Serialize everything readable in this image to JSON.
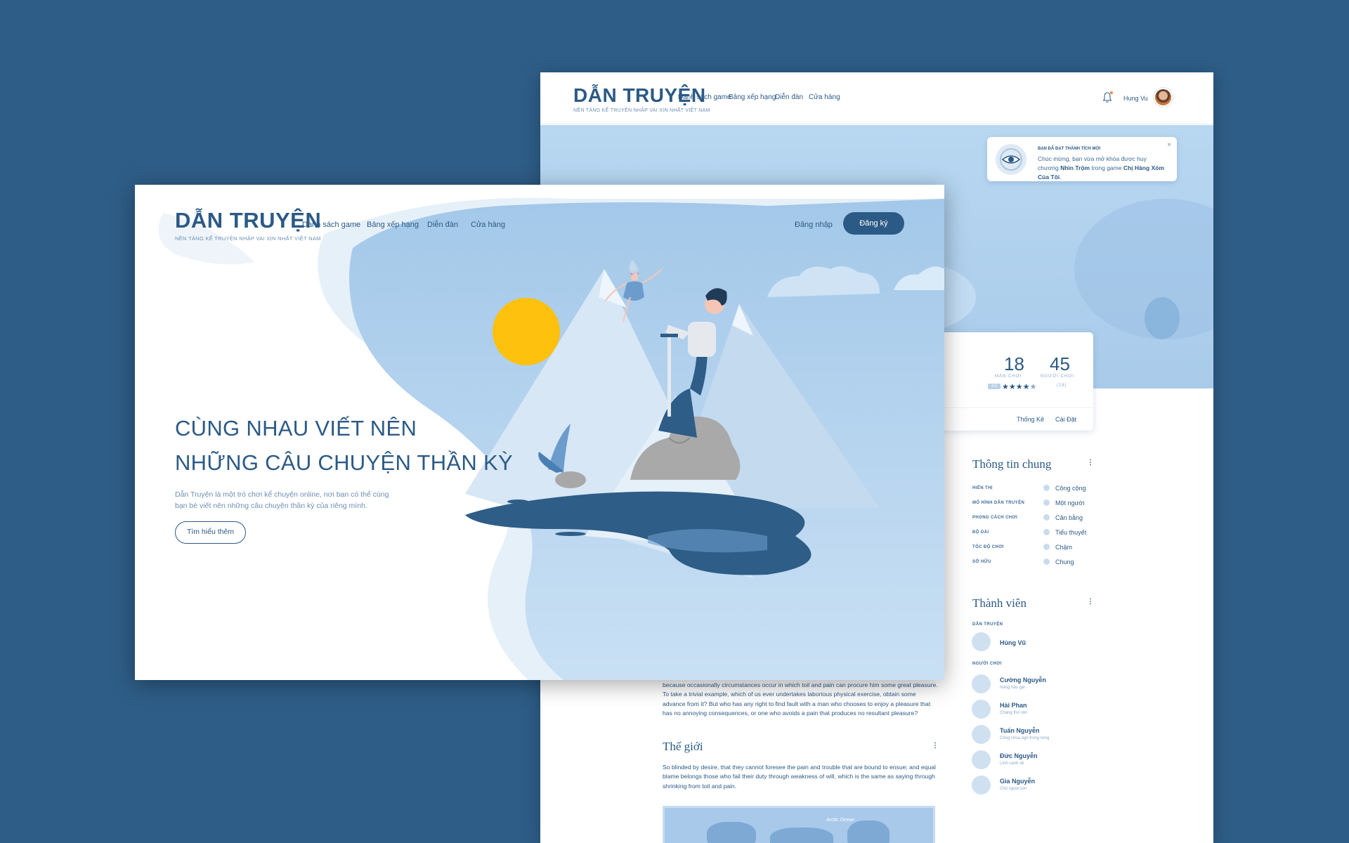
{
  "brand": {
    "name": "DẪN TRUYỆN",
    "tagline": "NỀN TẢNG KỂ TRUYỆN NHẬP VAI XỊN NHẤT VIỆT NAM"
  },
  "nav": {
    "items": [
      "Danh sách game",
      "Bảng xếp hạng",
      "Diễn đàn",
      "Cửa hàng"
    ],
    "login": "Đăng nhập",
    "signup": "Đăng ký"
  },
  "hero": {
    "headline_line1": "CÙNG NHAU VIẾT NÊN",
    "headline_line2": "NHỮNG CÂU CHUYỆN THẦN KỲ",
    "description": "Dẫn Truyện là một trò chơi kể chuyện online, nơi bạn có thể cùng bạn bè viết nên những câu chuyện thần kỳ của riêng mình.",
    "cta": "Tìm hiểu thêm"
  },
  "user": {
    "name": "Hung Vu"
  },
  "notification": {
    "title": "BẠN ĐÃ ĐẠT THÀNH TÍCH MỚI",
    "text_before": "Chúc mừng, bạn vừa mở khóa được huy chương ",
    "badge": "Nhìn Trộm",
    "text_middle": " trong game ",
    "game": "Chị Hàng Xóm Của Tôi",
    "text_after": ".",
    "close": "×"
  },
  "stats": {
    "chapters_value": "18",
    "chapters_label": "MÀN CHƠI",
    "players_value": "45",
    "players_label": "NGƯỜI CHƠI",
    "rating_tag": "4.5",
    "rating": 4.5,
    "rating_count": "(28)",
    "tab_stats": "Thống Kê",
    "tab_settings": "Cài Đặt"
  },
  "info": {
    "title": "Thông tin chung",
    "rows": [
      {
        "key": "HIỂN THỊ",
        "icon": "globe-icon",
        "value": "Công cộng"
      },
      {
        "key": "MÔ HÌNH DẪN TRUYỆN",
        "icon": "user-icon",
        "value": "Một người"
      },
      {
        "key": "PHONG CÁCH CHƠI",
        "icon": "balance-icon",
        "value": "Cân bằng"
      },
      {
        "key": "ĐỘ DÀI",
        "icon": "book-icon",
        "value": "Tiểu thuyết"
      },
      {
        "key": "TỐC ĐỘ CHƠI",
        "icon": "turtle-icon",
        "value": "Chậm"
      },
      {
        "key": "SỞ HỮU",
        "icon": "share-icon",
        "value": "Chung"
      }
    ]
  },
  "members": {
    "title": "Thành viên",
    "narrator_label": "DẪN TRUYỆN",
    "narrator": "Hùng Vũ",
    "players_label": "NGƯỜI CHƠI",
    "players": [
      {
        "name": "Cường Nguyễn",
        "role": "Nàng hầu gái"
      },
      {
        "name": "Hải Phan",
        "role": "Chàng thợ rèn"
      },
      {
        "name": "Tuấn Nguyễn",
        "role": "Công chúa ngủ trong rừng"
      },
      {
        "name": "Đức Nguyễn",
        "role": "Lính canh về"
      },
      {
        "name": "Gia Nguyễn",
        "role": "Chú ngựa con"
      }
    ]
  },
  "story": {
    "intro": "because occasionally circumstances occur in which toil and pain can procure him some great pleasure. To take a trivial example, which of us ever undertakes laborious physical exercise, obtain some advance from it? But who has any right to find fault with a man who chooses to enjoy a pleasure that has no annoying consequences, or one who avoids a pain that produces no resultant pleasure?",
    "world_title": "Thế giới",
    "world_text": "So blinded by desire, that they cannot foresee the pain and trouble that are bound to ensue; and equal blame belongs those who fail their duty through weakness of will, which is the same as saying through shrinking from toil and pain.",
    "map_label": "Arctic Ocean"
  },
  "colors": {
    "background": "#2e5d87",
    "primary": "#2c5a86",
    "sky": "#b8d7f1",
    "sun": "#fdc10e",
    "lake": "#2e5d87"
  }
}
